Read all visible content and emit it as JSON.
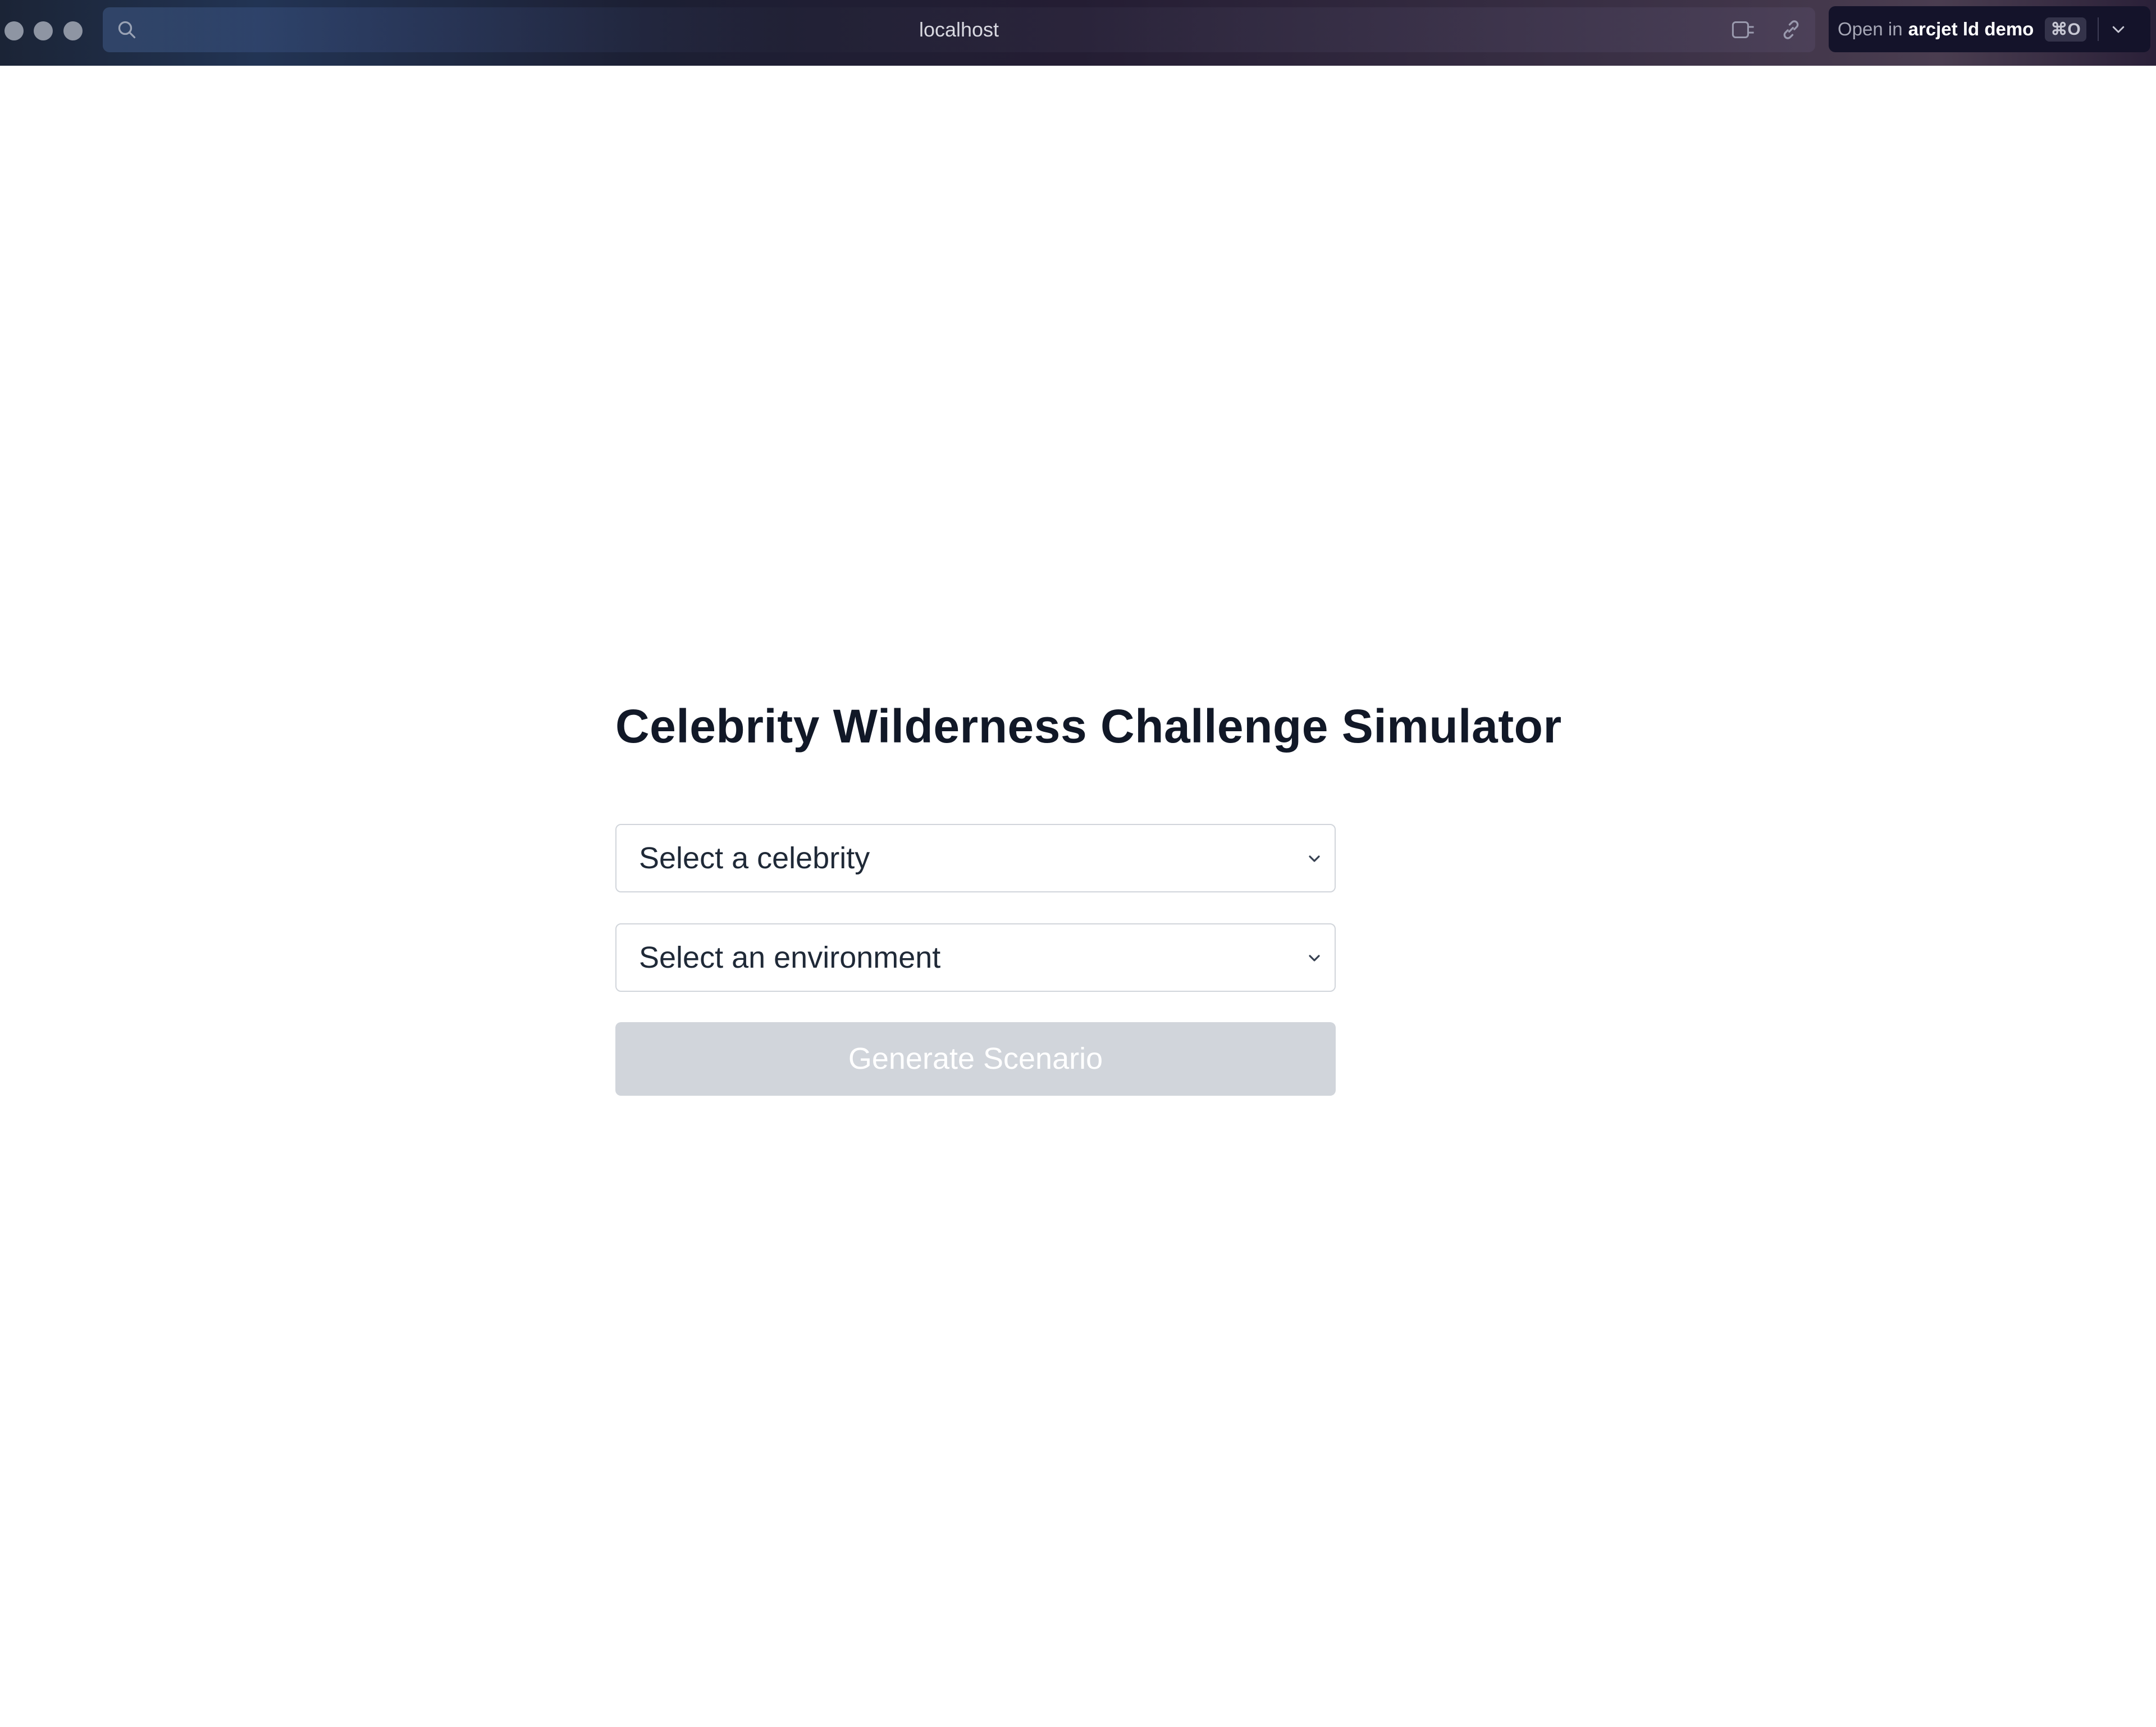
{
  "browser": {
    "url": "localhost",
    "open_in": {
      "prefix": "Open in",
      "app": "arcjet ld demo",
      "shortcut": "⌘O"
    }
  },
  "page": {
    "title": "Celebrity Wilderness Challenge Simulator",
    "celebrity_select": {
      "selected": "Select a celebrity"
    },
    "environment_select": {
      "selected": "Select an environment"
    },
    "generate_button": {
      "label": "Generate Scenario",
      "state": "disabled"
    }
  },
  "colors": {
    "title_text": "#111827",
    "select_border": "#d1d5db",
    "button_disabled_bg": "#d1d5db",
    "button_text": "#ffffff"
  }
}
